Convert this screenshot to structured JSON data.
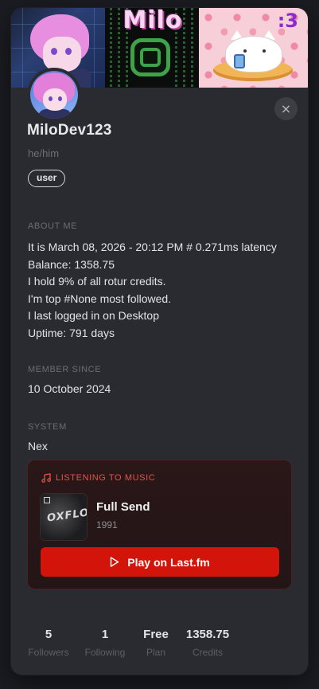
{
  "profile": {
    "username": "MiloDev123",
    "pronouns": "he/him",
    "role": "user",
    "close_label": "×"
  },
  "banner": {
    "panel_b_text": "Milo",
    "panel_c_text": ":3"
  },
  "about": {
    "label": "ABOUT ME",
    "lines": [
      "It is March 08, 2026 - 20:12 PM # 0.271ms latency",
      "Balance: 1358.75",
      "I hold 9% of all rotur credits.",
      "I'm top #None most followed.",
      "I last logged in on Desktop",
      "Uptime: 791 days"
    ]
  },
  "member_since": {
    "label": "MEMBER SINCE",
    "value": "10 October 2024"
  },
  "system": {
    "label": "SYSTEM",
    "value": "Nex"
  },
  "music": {
    "header": "LISTENING TO MUSIC",
    "album_art_text": "OXFLO",
    "track_title": "Full Send",
    "track_sub": "1991",
    "play_label": "Play on Last.fm",
    "accent_color": "#d2140b",
    "header_color": "#e2544d"
  },
  "stats": [
    {
      "value": "5",
      "label": "Followers"
    },
    {
      "value": "1",
      "label": "Following"
    },
    {
      "value": "Free",
      "label": "Plan"
    },
    {
      "value": "1358.75",
      "label": "Credits"
    }
  ],
  "icons": {
    "close": "close-icon",
    "music": "music-note-icon",
    "play": "play-icon"
  }
}
